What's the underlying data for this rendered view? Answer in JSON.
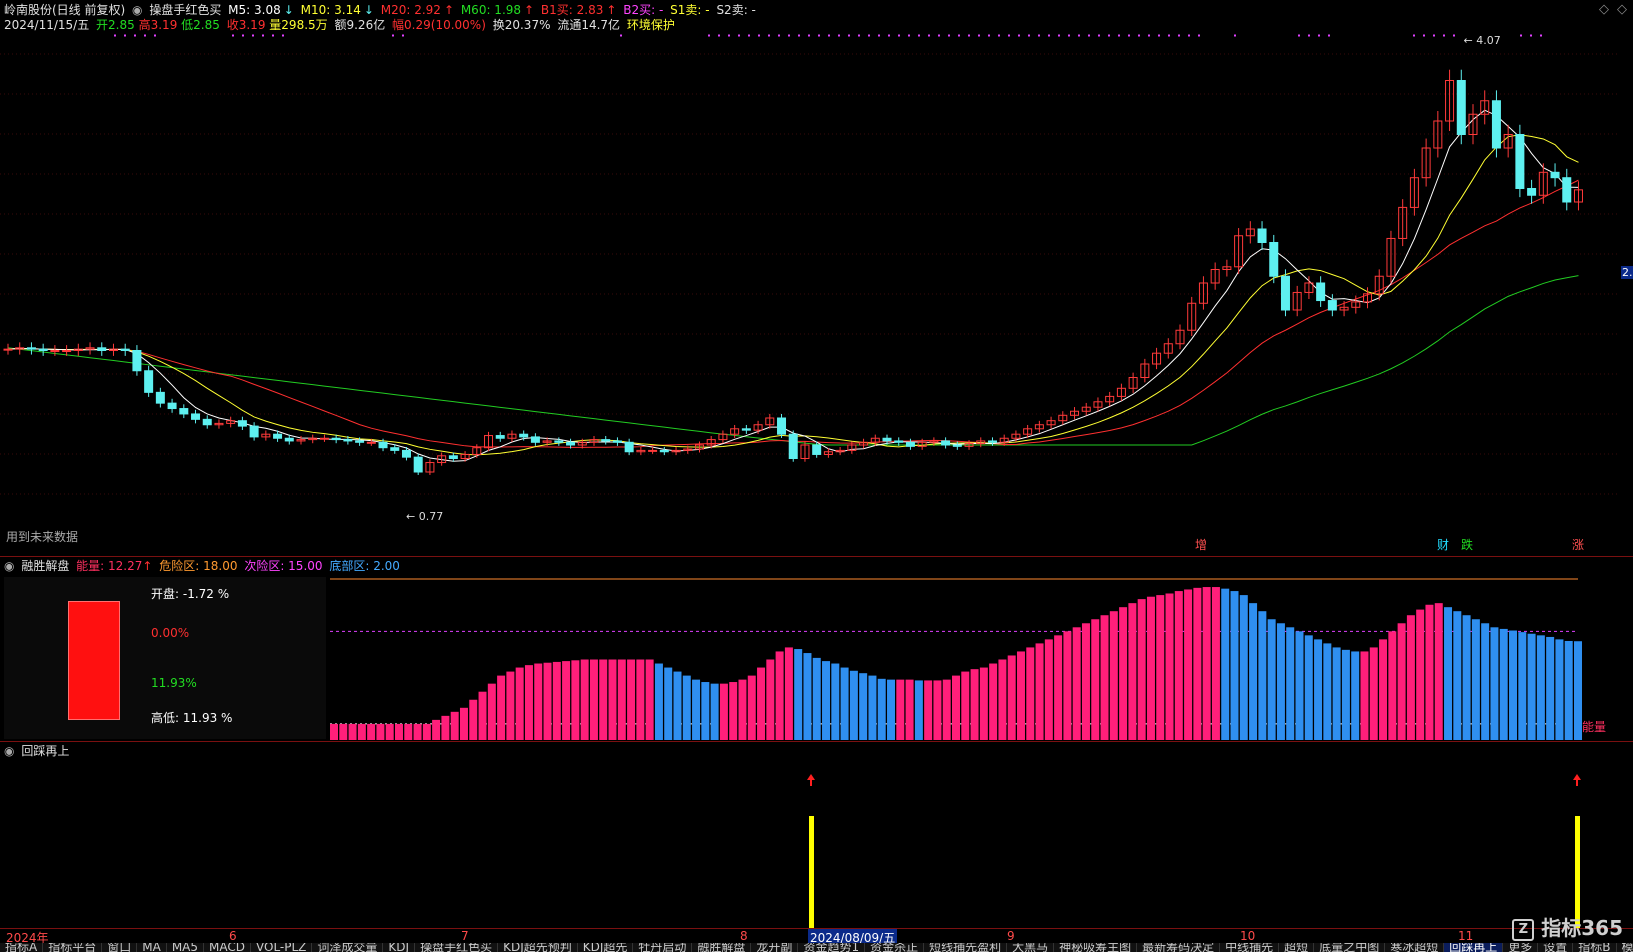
{
  "stock": {
    "name": "岭南股份(日线 前复权)",
    "strategy": "操盘手红色买"
  },
  "ma": {
    "m5": "M5: 3.08",
    "m10": "M10: 3.14",
    "m20": "M20: 2.92",
    "m60": "M60: 1.98",
    "b1": "B1买: 2.83",
    "b2": "B2买: -",
    "s1": "S1卖: -",
    "s2": "S2卖: -"
  },
  "quote": {
    "date": "2024/11/15/五",
    "open": "开2.85",
    "high": "高3.19",
    "low": "低2.85",
    "close": "收3.19",
    "volume": "量298.5万",
    "amount": "额9.26亿",
    "change": "幅0.29(10.00%)",
    "turnover": "换20.37%",
    "float": "流通14.7亿",
    "env": "环境保护"
  },
  "price_labels": {
    "max": "4.07",
    "min": "0.77",
    "future": "用到未来数据",
    "right_value": "2."
  },
  "signals": {
    "zeng": "增",
    "cai": "财",
    "die": "跌",
    "zhang": "涨"
  },
  "indicator1": {
    "title": "融胜解盘",
    "energy": "能量: 12.27",
    "danger": "危险区: 18.00",
    "next_danger": "次险区: 15.00",
    "bottom": "底部区: 2.00",
    "open_pct": "开盘: -1.72 %",
    "red_pct": "0.00%",
    "green_pct": "11.93%",
    "range": "高低: 11.93 %",
    "side_label": "能量"
  },
  "indicator2": {
    "title": "回踩再上"
  },
  "time_axis": {
    "year": "2024年",
    "m6": "6",
    "m7": "7",
    "m8": "8",
    "cursor_date": "2024/08/09/五",
    "m9": "9",
    "m10": "10",
    "m11": "11"
  },
  "tabs": [
    "指标A",
    "指标平台",
    "窗口",
    "MA",
    "MA5",
    "MACD",
    "VOL-PLZ",
    "词泽成交量",
    "KDJ",
    "操盘手红色买",
    "KDJ超先预判",
    "KDJ超先",
    "牡丹启动",
    "融胜解盘",
    "龙开副",
    "资金趋势1",
    "资金杀正",
    "短线捕先盈利",
    "大黑马",
    "神秘吸筹主图",
    "最新筹码决定",
    "中线捕先",
    "超短",
    "底量之中图",
    "寒冰超短",
    "回踩再上",
    "更多",
    "设置",
    "指标B",
    "模板"
  ],
  "active_tab": "回踩再上",
  "watermark": "指标365",
  "colors": {
    "up": "#ff3a3a",
    "down": "#5ef0f0",
    "ma5": "#ffffff",
    "ma10": "#ffff33",
    "ma20": "#ff3030",
    "ma60": "#22cc22",
    "pink": "#ff1f7a",
    "blue": "#2f8ff0"
  },
  "chart_data": {
    "type": "candlestick",
    "close": [
      2.01,
      2.02,
      2.01,
      2.0,
      2.0,
      2.0,
      2.01,
      2.02,
      2.0,
      2.01,
      2.0,
      1.85,
      1.69,
      1.61,
      1.57,
      1.53,
      1.49,
      1.45,
      1.46,
      1.48,
      1.44,
      1.36,
      1.38,
      1.35,
      1.33,
      1.34,
      1.35,
      1.35,
      1.34,
      1.33,
      1.32,
      1.32,
      1.28,
      1.26,
      1.21,
      1.1,
      1.17,
      1.22,
      1.2,
      1.23,
      1.28,
      1.37,
      1.35,
      1.38,
      1.36,
      1.32,
      1.33,
      1.32,
      1.3,
      1.32,
      1.34,
      1.33,
      1.32,
      1.25,
      1.26,
      1.26,
      1.25,
      1.26,
      1.27,
      1.3,
      1.34,
      1.38,
      1.42,
      1.41,
      1.45,
      1.5,
      1.38,
      1.2,
      1.3,
      1.23,
      1.25,
      1.26,
      1.3,
      1.32,
      1.35,
      1.33,
      1.32,
      1.29,
      1.32,
      1.33,
      1.3,
      1.29,
      1.31,
      1.33,
      1.32,
      1.35,
      1.38,
      1.42,
      1.45,
      1.48,
      1.52,
      1.55,
      1.58,
      1.62,
      1.66,
      1.72,
      1.8,
      1.9,
      1.98,
      2.05,
      2.15,
      2.35,
      2.5,
      2.6,
      2.62,
      2.85,
      2.9,
      2.8,
      2.55,
      2.3,
      2.43,
      2.5,
      2.37,
      2.3,
      2.32,
      2.36,
      2.42,
      2.55,
      2.83,
      3.06,
      3.28,
      3.5,
      3.7,
      4.0,
      3.6,
      3.75,
      3.85,
      3.5,
      3.6,
      3.2,
      3.15,
      3.32,
      3.28,
      3.1,
      3.19
    ],
    "ylim": [
      0.7,
      4.3
    ],
    "indicator1_values": [
      2,
      2,
      2,
      2,
      2,
      2,
      2,
      2,
      2,
      2,
      2,
      2.5,
      3,
      3.5,
      4,
      5,
      6,
      7,
      8,
      8.5,
      9,
      9.3,
      9.5,
      9.6,
      9.7,
      9.8,
      9.9,
      10,
      10,
      10,
      10,
      10,
      10,
      10,
      10,
      9.5,
      9,
      8.5,
      8,
      7.5,
      7.2,
      7,
      7,
      7.2,
      7.5,
      8,
      9,
      10,
      11,
      11.5,
      11.3,
      10.8,
      10.2,
      9.8,
      9.5,
      9,
      8.6,
      8.3,
      8,
      7.6,
      7.5,
      7.5,
      7.5,
      7.4,
      7.4,
      7.4,
      7.5,
      8,
      8.5,
      8.8,
      9,
      9.5,
      10,
      10.5,
      11,
      11.5,
      12,
      12.5,
      13,
      13.5,
      14,
      14.5,
      15,
      15.5,
      16,
      16.5,
      17,
      17.5,
      17.8,
      18,
      18.2,
      18.5,
      18.7,
      18.9,
      19,
      19,
      18.8,
      18.5,
      18,
      17,
      16,
      15,
      14.5,
      14,
      13.5,
      13,
      12.5,
      12,
      11.5,
      11.2,
      11,
      11,
      11.5,
      12.5,
      13.5,
      14.5,
      15.5,
      16.2,
      16.8,
      17,
      16.5,
      16,
      15.5,
      15,
      14.5,
      14,
      13.8,
      13.6,
      13.4,
      13.2,
      13,
      12.8,
      12.5,
      12.3,
      12.27
    ],
    "indicator2_signals": [
      66,
      129
    ]
  }
}
